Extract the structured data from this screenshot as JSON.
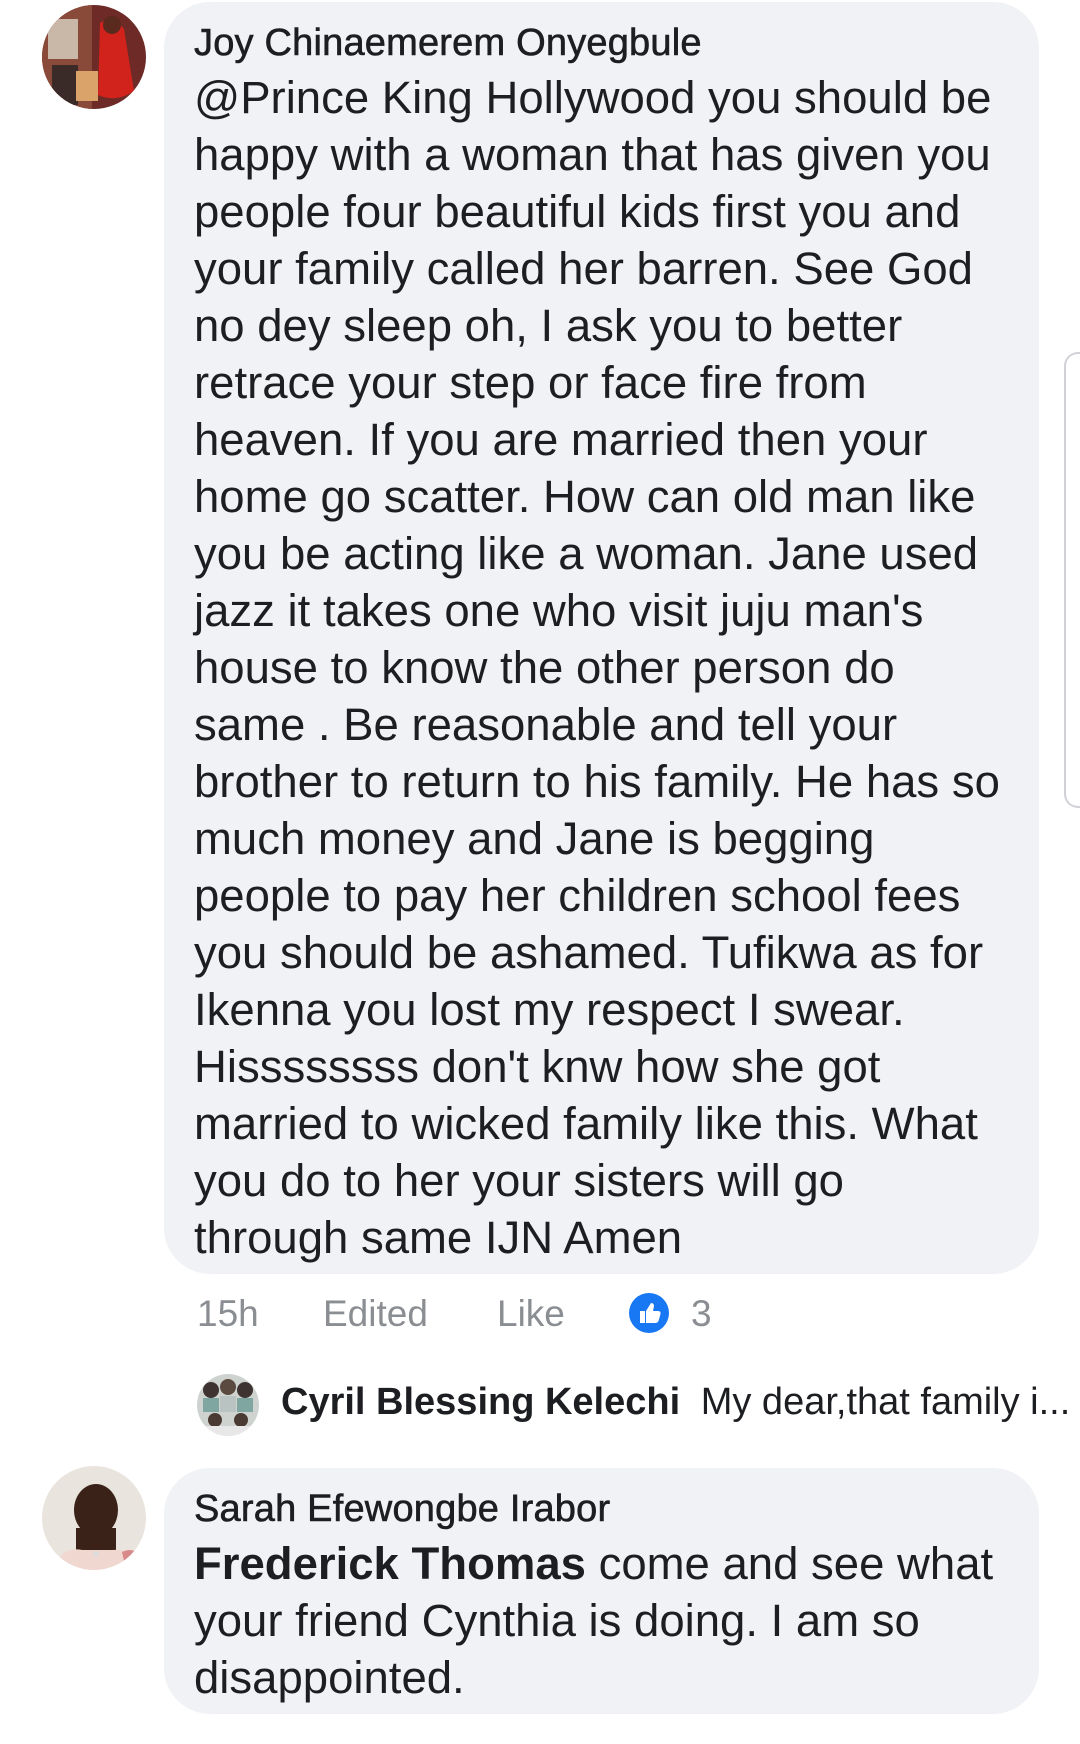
{
  "comments": [
    {
      "author": "Joy Chinaemerem Onyegbule",
      "lines": [
        "@Prince King Hollywood you should be",
        "happy with a woman that has given you",
        "people four beautiful kids first you and",
        "your family called her barren. See God",
        "no dey sleep oh, I ask you to better",
        "retrace your step or face fire from",
        "heaven. If you are married then your",
        "home go scatter. How can old man like",
        "you be acting like a woman. Jane used",
        "jazz it takes one who visit juju man's",
        "house to know the other person do",
        "same . Be reasonable and tell your",
        "brother to return to his family. He has so",
        "much money and Jane is begging",
        "people to pay her children school fees",
        "you should be ashamed. Tufikwa as for",
        "Ikenna you lost my respect I swear.",
        "Hissssssss don't knw how she got",
        "married to wicked family like this. What",
        "you do to her your sisters will go",
        "through same IJN Amen"
      ],
      "time": "15h",
      "edited": "Edited",
      "like": "Like",
      "reaction_count": "3",
      "reply": {
        "name": "Cyril Blessing Kelechi",
        "snippet": "My dear,that family i..."
      }
    },
    {
      "author": "Sarah Efewongbe Irabor",
      "mention": "Frederick Thomas",
      "first_line_rest": " come and see what",
      "lines": [
        "your friend Cynthia is doing. I am so",
        "disappointed."
      ]
    }
  ],
  "colors": {
    "bubble": "#f0f2f5",
    "meta_text": "#8a8d91",
    "like_blue": "#1877f2"
  },
  "icons": {
    "reaction": "thumbs-up-icon"
  }
}
